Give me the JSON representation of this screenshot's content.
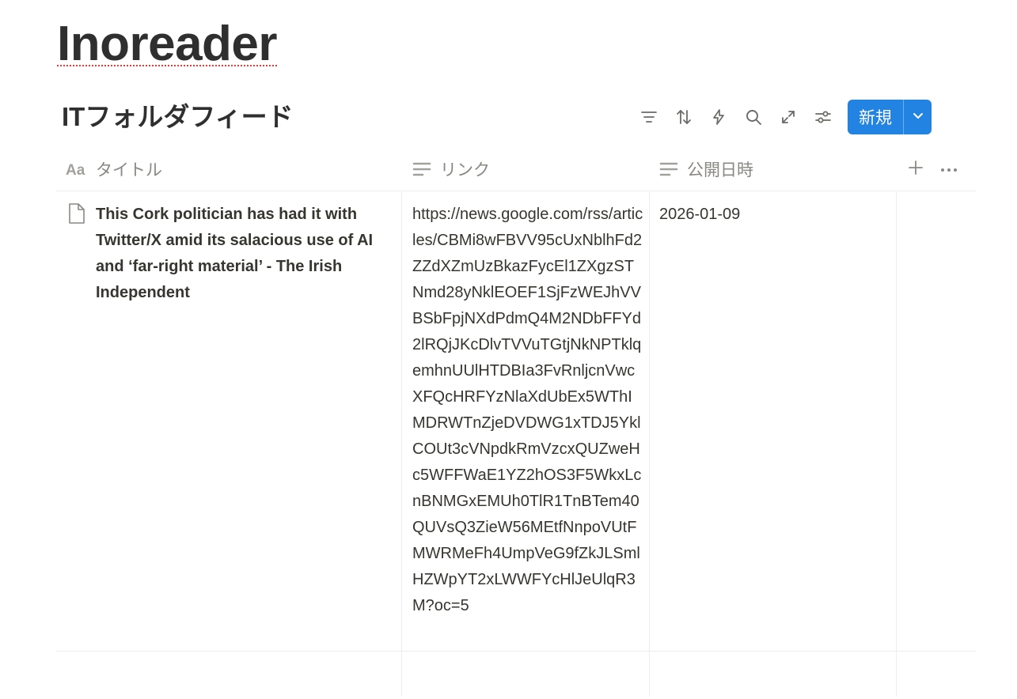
{
  "page": {
    "title": "Inoreader"
  },
  "view": {
    "title": "ITフォルダフィード"
  },
  "toolbar": {
    "icons": [
      "filter-icon",
      "sort-icon",
      "lightning-icon",
      "search-icon",
      "expand-icon",
      "settings-sliders-icon"
    ],
    "new_label": "新規",
    "accent": "#2383e2"
  },
  "table": {
    "columns": [
      {
        "label": "タイトル",
        "icon": "title-aa-icon"
      },
      {
        "label": "リンク",
        "icon": "text-lines-icon"
      },
      {
        "label": "公開日時",
        "icon": "text-lines-icon"
      }
    ],
    "rows": [
      {
        "title": "This Cork politician has had it with Twitter/X amid its salacious use of AI and ‘far-right material’ - The Irish Independent",
        "link": "https://news.google.com/rss/articles/CBMi8wFBVV95cUxNblhFd2ZZdXZmUzBkazFycEl1ZXgzSTNmd28yNklEOEF1SjFzWEJhVVBSbFpjNXdPdmQ4M2NDbFFYd2lRQjJKcDlvTVVuTGtjNkNPTklqemhnUUlHTDBIa3FvRnljcnVwcXFQcHRFYzNlaXdUbEx5WThIMDRWTnZjeDVDWG1xTDJ5YklCOUt3cVNpdkRmVzcxQUZweHc5WFFWaE1YZ2hOS3F5WkxLcnBNMGxEMUh0TlR1TnBTem40QUVsQ3ZieW56MEtfNnpoVUtFMWRMeFh4UmpVeG9fZkJLSmlHZWpYT2xLWWFYcHlJeUlqR3M?oc=5",
        "date": "2026-01-09"
      }
    ]
  }
}
